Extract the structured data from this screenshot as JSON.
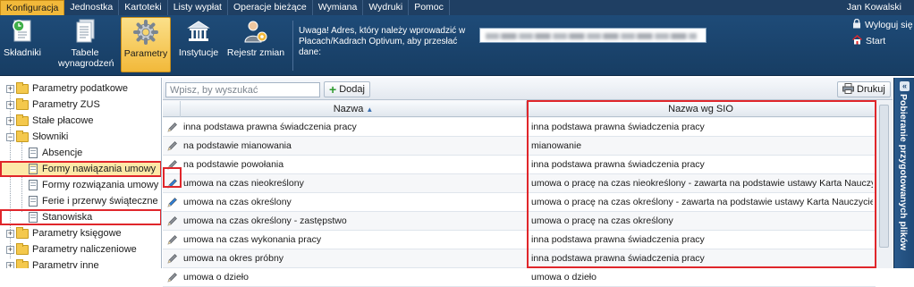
{
  "menubar": {
    "tabs": [
      "Konfiguracja",
      "Jednostka",
      "Kartoteki",
      "Listy wypłat",
      "Operacje bieżące",
      "Wymiana",
      "Wydruki",
      "Pomoc"
    ],
    "user": "Jan Kowalski"
  },
  "ribbon": {
    "buttons": [
      {
        "label": "Składniki",
        "icon": "clock-document-icon"
      },
      {
        "label": "Tabele wynagrodzeń",
        "icon": "document-stack-icon"
      },
      {
        "label": "Parametry",
        "icon": "gear-icon"
      },
      {
        "label": "Instytucje",
        "icon": "building-icon"
      },
      {
        "label": "Rejestr zmian",
        "icon": "user-gear-icon"
      }
    ],
    "notice": "Uwaga! Adres, który należy wprowadzić w Płacach/Kadrach Optivum, aby przesłać dane:",
    "logout": "Wyloguj się",
    "start": "Start"
  },
  "tree": {
    "items": [
      {
        "label": "Parametry podatkowe",
        "expander": "+"
      },
      {
        "label": "Parametry ZUS",
        "expander": "+"
      },
      {
        "label": "Stałe płacowe",
        "expander": "+"
      },
      {
        "label": "Słowniki",
        "expander": "−"
      },
      {
        "label": "Absencje"
      },
      {
        "label": "Formy nawiązania umowy"
      },
      {
        "label": "Formy rozwiązania umowy"
      },
      {
        "label": "Ferie i przerwy świąteczne"
      },
      {
        "label": "Stanowiska"
      },
      {
        "label": "Parametry księgowe",
        "expander": "+"
      },
      {
        "label": "Parametry naliczeniowe",
        "expander": "+"
      },
      {
        "label": "Parametry inne",
        "expander": "+"
      }
    ]
  },
  "toolbar": {
    "search_placeholder": "Wpisz, by wyszukać",
    "add_label": "Dodaj",
    "print_label": "Drukuj"
  },
  "grid": {
    "columns": [
      "Nazwa",
      "Nazwa wg SIO"
    ],
    "rows": [
      {
        "name": "inna podstawa prawna świadczenia pracy",
        "sio": "inna podstawa prawna świadczenia pracy",
        "pen": "gray"
      },
      {
        "name": "na podstawie mianowania",
        "sio": "mianowanie",
        "pen": "gray"
      },
      {
        "name": "na podstawie powołania",
        "sio": "inna podstawa prawna świadczenia pracy",
        "pen": "gray"
      },
      {
        "name": "umowa na czas nieokreślony",
        "sio": "umowa o pracę na czas nieokreślony - zawarta na podstawie ustawy Karta Nauczyciela",
        "pen": "blue"
      },
      {
        "name": "umowa na czas określony",
        "sio": "umowa o pracę na czas określony - zawarta na podstawie ustawy Karta Nauczyciela",
        "pen": "blue"
      },
      {
        "name": "umowa na czas określony - zastępstwo",
        "sio": "umowa o pracę na czas określony",
        "pen": "gray"
      },
      {
        "name": "umowa na czas wykonania pracy",
        "sio": "inna podstawa prawna świadczenia pracy",
        "pen": "gray"
      },
      {
        "name": "umowa na okres próbny",
        "sio": "inna podstawa prawna świadczenia pracy",
        "pen": "gray"
      },
      {
        "name": "umowa o dzieło",
        "sio": "umowa o dzieło",
        "pen": "gray"
      }
    ]
  },
  "sidepanel": {
    "label": "Pobieranie przygotowanych plików"
  },
  "colors": {
    "accent": "#f2b93a",
    "highlight": "#e0262b",
    "nav": "#1f3f63"
  }
}
